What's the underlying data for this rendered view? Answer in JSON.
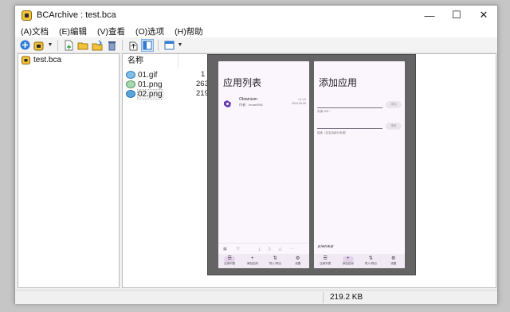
{
  "window": {
    "title": "BCArchive : test.bca",
    "controls": {
      "minimize": "—",
      "maximize": "☐",
      "close": "✕"
    }
  },
  "menu": [
    "(A)文档",
    "(E)编辑",
    "(V)查看",
    "(O)选项",
    "(H)帮助"
  ],
  "tree": {
    "root": "test.bca"
  },
  "list": {
    "column_name": "名称",
    "files": [
      {
        "name": "01.gif",
        "size": "1"
      },
      {
        "name": "01.png",
        "size": "263"
      },
      {
        "name": "02.png",
        "size": "219"
      }
    ]
  },
  "status": {
    "size": "219.2 KB"
  },
  "preview": {
    "screen1": {
      "title": "应用列表",
      "app": {
        "name": "Obtainium",
        "author": "作者：ImranR98",
        "version": "v1.1.0",
        "date": "2024-05-05"
      },
      "nav": [
        {
          "icon": "☰",
          "label": "应用列表"
        },
        {
          "icon": "+",
          "label": "添加应用"
        },
        {
          "icon": "⇅",
          "label": "导入/导出"
        },
        {
          "icon": "⚙",
          "label": "设置"
        }
      ]
    },
    "screen2": {
      "title": "添加应用",
      "url_label": "来源 URL *",
      "url_button": "添加",
      "search_label": "搜索（仅支持部分来源）",
      "search_button": "搜索",
      "supported": "支持的来源",
      "nav": [
        {
          "icon": "☰",
          "label": "应用列表"
        },
        {
          "icon": "+",
          "label": "添加应用"
        },
        {
          "icon": "⇅",
          "label": "导入/导出"
        },
        {
          "icon": "⚙",
          "label": "设置"
        }
      ]
    }
  },
  "colors": {
    "accent": "#2f7bd6",
    "folder": "#f2c23a",
    "image_icon": "#5aa5d8"
  }
}
